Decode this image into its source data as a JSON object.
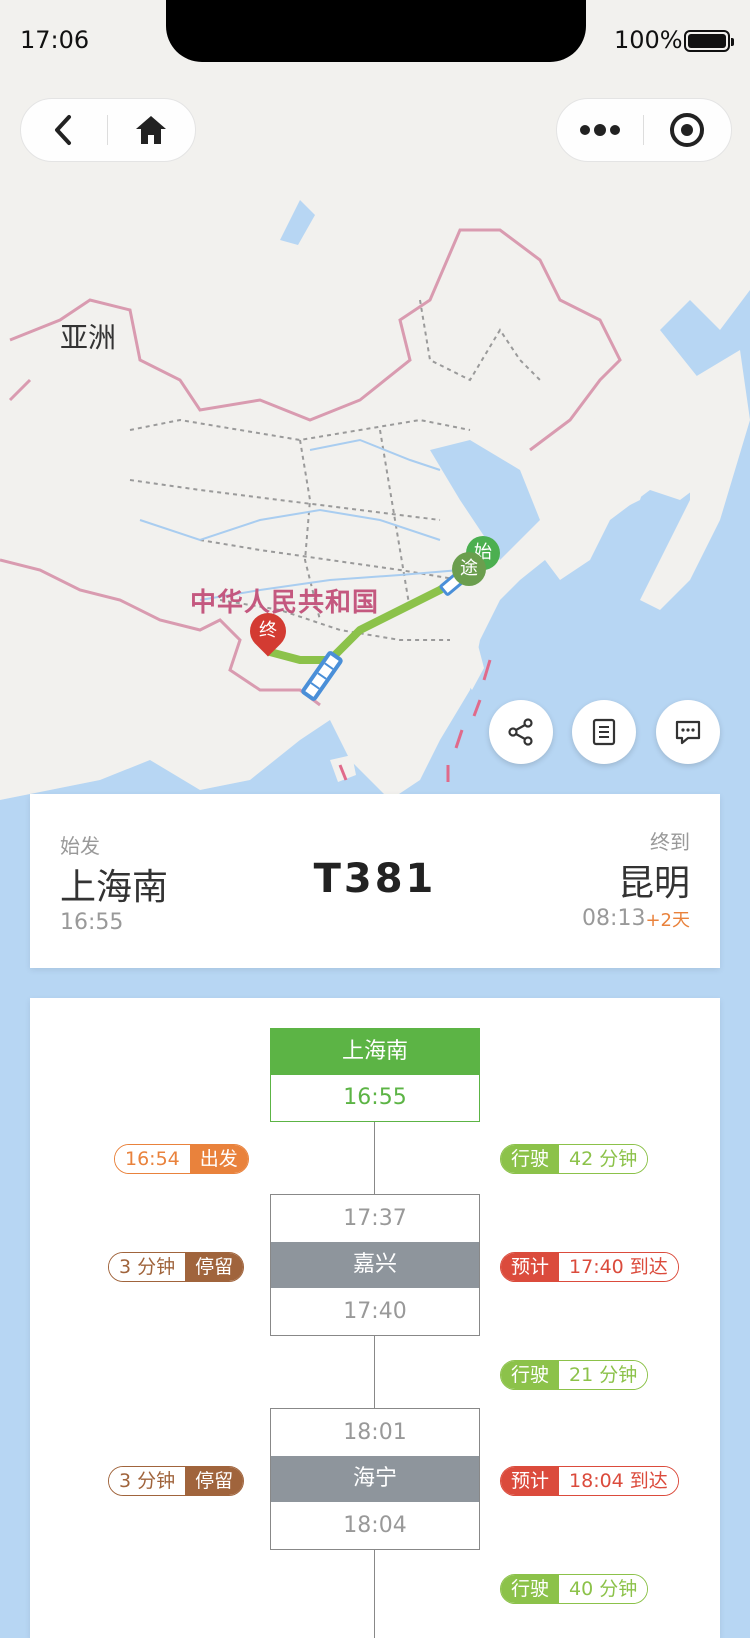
{
  "status_bar": {
    "time": "17:06",
    "battery_percent": "100%"
  },
  "map": {
    "continent_label": "亚洲",
    "country_label": "中华人民共和国",
    "markers": {
      "start": "始",
      "via": "途",
      "end": "终"
    }
  },
  "colors": {
    "green": "#5cb445",
    "orange": "#e9823c",
    "brown": "#a0643c",
    "light_green": "#8cc24a",
    "red": "#db4b3c",
    "gray": "#8e959c"
  },
  "summary": {
    "from_label": "始发",
    "from_station": "上海南",
    "from_time": "16:55",
    "train_number": "T381",
    "to_label": "终到",
    "to_station": "昆明",
    "to_time": "08:13",
    "to_day_offset": "+2天"
  },
  "timeline": {
    "first_stop": {
      "name": "上海南",
      "time": "16:55",
      "actual_time": "16:54",
      "status": "出发",
      "run_label": "行驶",
      "run_duration": "42 分钟"
    },
    "stops": [
      {
        "name": "嘉兴",
        "arrive": "17:37",
        "depart": "17:40",
        "stay": "3 分钟",
        "stay_label": "停留",
        "eta_label": "预计",
        "eta": "17:40 到达",
        "run_label": "行驶",
        "run_duration": "21 分钟"
      },
      {
        "name": "海宁",
        "arrive": "18:01",
        "depart": "18:04",
        "stay": "3 分钟",
        "stay_label": "停留",
        "eta_label": "预计",
        "eta": "18:04 到达",
        "run_label": "行驶",
        "run_duration": "40 分钟"
      }
    ]
  }
}
